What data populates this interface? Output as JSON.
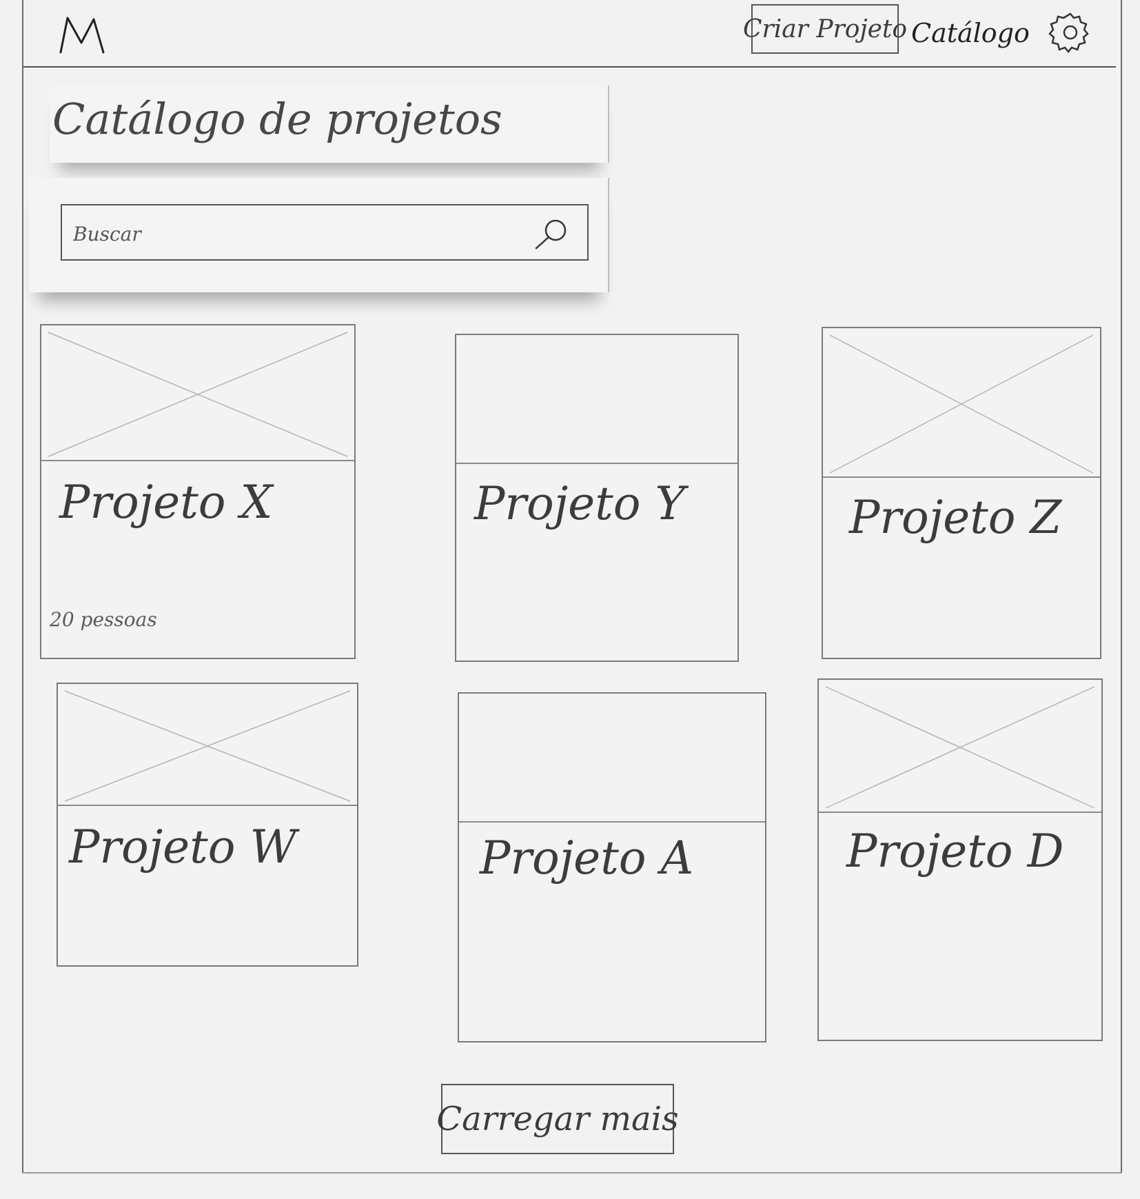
{
  "header": {
    "logo_text": "M",
    "create_button_label": "Criar Projeto",
    "catalog_link_label": "Catálogo",
    "settings_icon": "gear-icon"
  },
  "main": {
    "title": "Catálogo de projetos",
    "search": {
      "placeholder": "Buscar",
      "icon": "search-icon"
    },
    "projects": [
      {
        "title": "Projeto X",
        "meta": "20 pessoas"
      },
      {
        "title": "Projeto Y"
      },
      {
        "title": "Projeto Z"
      },
      {
        "title": "Projeto W"
      },
      {
        "title": "Projeto A"
      },
      {
        "title": "Projeto D"
      }
    ],
    "load_more_label": "Carregar mais"
  }
}
